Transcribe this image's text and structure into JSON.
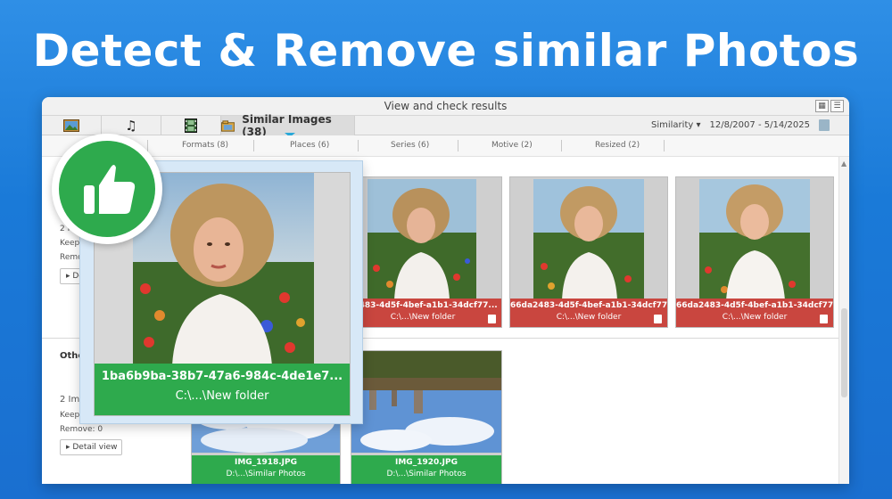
{
  "headline": "Detect & Remove similar Photos",
  "window": {
    "title": "View and check results"
  },
  "tabs": {
    "active_label": "Similar Images (38)",
    "icons": [
      "image-icon",
      "music-note-icon",
      "film-icon",
      "folder-image-icon"
    ]
  },
  "filter": {
    "similarity_label": "Similarity",
    "date_range": "12/8/2007 - 5/14/2025"
  },
  "subtabs": [
    "Formats (8)",
    "Places (6)",
    "Series (6)",
    "Motive (2)",
    "Resized (2)"
  ],
  "group1": {
    "count": "2 I",
    "keep": "Keep:",
    "remove": "Remo",
    "detail": "▸ De"
  },
  "group2": {
    "heading": "Othe",
    "count": "2 Im",
    "keep": "Keep:",
    "remove": "Remove: 0",
    "detail": "▸ Detail view"
  },
  "cards_row1": [
    {
      "name": "a2483-4d5f-4bef-a1b1-34dcf77...",
      "folder": "C:\\...\\New folder"
    },
    {
      "name": "66da2483-4d5f-4bef-a1b1-34dcf77...",
      "folder": "C:\\...\\New folder"
    },
    {
      "name": "66da2483-4d5f-4bef-a1b1-34dcf77...",
      "folder": "C:\\...\\New folder"
    }
  ],
  "cards_row2": [
    {
      "name": "IMG_1918.JPG",
      "folder": "D:\\...\\Similar Photos"
    },
    {
      "name": "IMG_1920.JPG",
      "folder": "D:\\...\\Similar Photos"
    }
  ],
  "popup": {
    "name": "1ba6b9ba-38b7-47a6-984c-4de1e7...",
    "folder": "C:\\...\\New folder"
  },
  "colors": {
    "keep_green": "#2eaa4d",
    "remove_red": "#c9463f",
    "background_blue": "#1a7ad8"
  }
}
